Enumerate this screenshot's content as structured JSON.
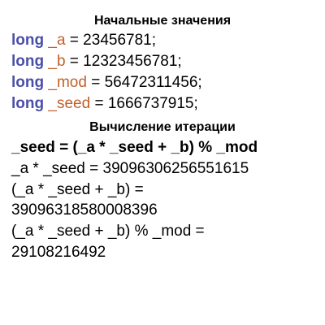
{
  "colors": {
    "keyword": "#4a4fa8",
    "variable": "#c0612b",
    "text": "#000000",
    "background": "#ffffff"
  },
  "section_initial": {
    "title": "Начальные значения",
    "declarations": [
      {
        "keyword": "long",
        "name": "_a",
        "rest": " = 23456781;"
      },
      {
        "keyword": "long",
        "name": "_b",
        "rest": " = 12323456781;"
      },
      {
        "keyword": "long",
        "name": "_mod",
        "rest": " = 56472311456;"
      },
      {
        "keyword": "long",
        "name": "_seed",
        "rest": " = 1666737915;"
      }
    ]
  },
  "section_iteration": {
    "title": "Вычисление итерации",
    "formula": "_seed = (_a * _seed + _b) % _mod",
    "lines": [
      "_a * _seed = 39096306256551615",
      "(_a * _seed + _b) =",
      "39096318580008396",
      "(_a * _seed + _b) % _mod =",
      "29108216492"
    ]
  }
}
